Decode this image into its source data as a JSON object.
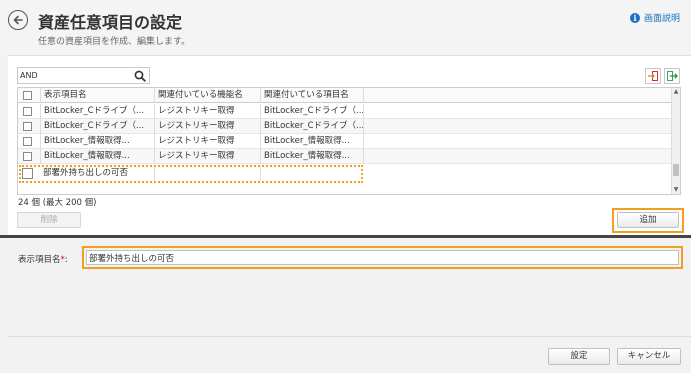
{
  "header": {
    "title": "資産任意項目の設定",
    "subtitle": "任意の資産項目を作成、編集します。",
    "help_label": "画面説明",
    "help_icon": "info-icon"
  },
  "search": {
    "value": "AND",
    "placeholder": ""
  },
  "grid": {
    "columns": [
      "表示項目名",
      "関連付いている機能名",
      "関連付いている項目名"
    ],
    "rows": [
      [
        "BitLocker_Cドライブ（...",
        "レジストリキー取得",
        "BitLocker_Cドライブ（..."
      ],
      [
        "BitLocker_Cドライブ（...",
        "レジストリキー取得",
        "BitLocker_Cドライブ（..."
      ],
      [
        "BitLocker_情報取得...",
        "レジストリキー取得",
        "BitLocker_情報取得..."
      ],
      [
        "BitLocker_情報取得...",
        "レジストリキー取得",
        "BitLocker_情報取得..."
      ],
      [
        "部署外持ち出しの可否",
        "",
        ""
      ]
    ]
  },
  "count_label": "24 個 (最大 200 個)",
  "buttons": {
    "delete": "削除",
    "add": "追加",
    "save": "設定",
    "cancel": "キャンセル"
  },
  "form": {
    "label": "表示項目名",
    "required_mark": "*",
    "colon": ":",
    "value": "部署外持ち出しの可否"
  },
  "colors": {
    "highlight": "#f0a01e",
    "link": "#1a6fc4"
  }
}
